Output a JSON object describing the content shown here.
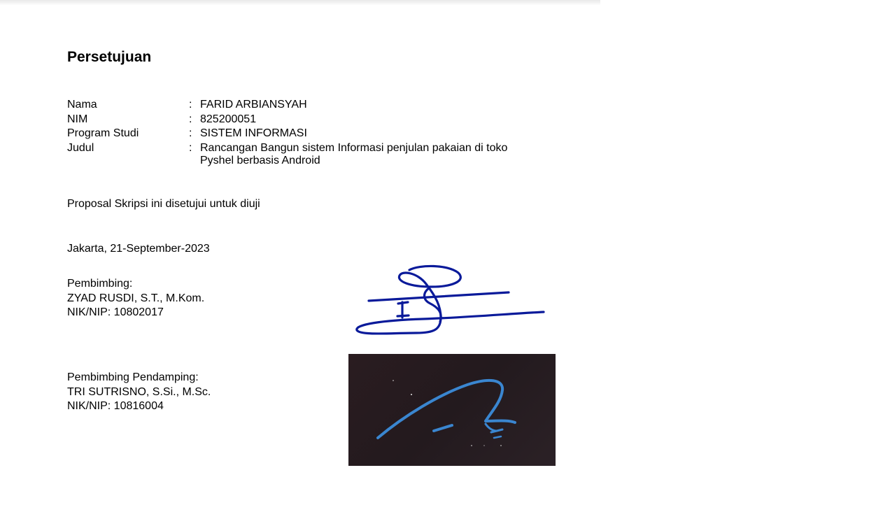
{
  "document": {
    "title": "Persetujuan",
    "fields": [
      {
        "label": "Nama",
        "colon": ":",
        "value": "FARID ARBIANSYAH"
      },
      {
        "label": "NIM",
        "colon": ":",
        "value": "825200051"
      },
      {
        "label": "Program Studi",
        "colon": ":",
        "value": "SISTEM INFORMASI"
      },
      {
        "label": "Judul",
        "colon": ":",
        "value": "Rancangan Bangun sistem Informasi penjulan pakaian di toko Pyshel berbasis Android"
      }
    ],
    "approval_statement": "Proposal Skripsi ini disetujui untuk diuji",
    "place_date": "Jakarta, 21-September-2023",
    "supervisor": {
      "role": "Pembimbing:",
      "name": "ZYAD RUSDI, S.T., M.Kom.",
      "id": "NIK/NIP: 10802017"
    },
    "co_supervisor": {
      "role": "Pembimbing Pendamping:",
      "name": "TRI SUTRISNO, S.Si., M.Sc.",
      "id": "NIK/NIP: 10816004"
    }
  },
  "colors": {
    "signature_1_ink": "#0a1a9a",
    "signature_2_ink": "#3a86d0",
    "signature_2_background": "#261c20"
  },
  "icons": {
    "signature_1": "handwritten-signature",
    "signature_2": "handwritten-signature"
  }
}
